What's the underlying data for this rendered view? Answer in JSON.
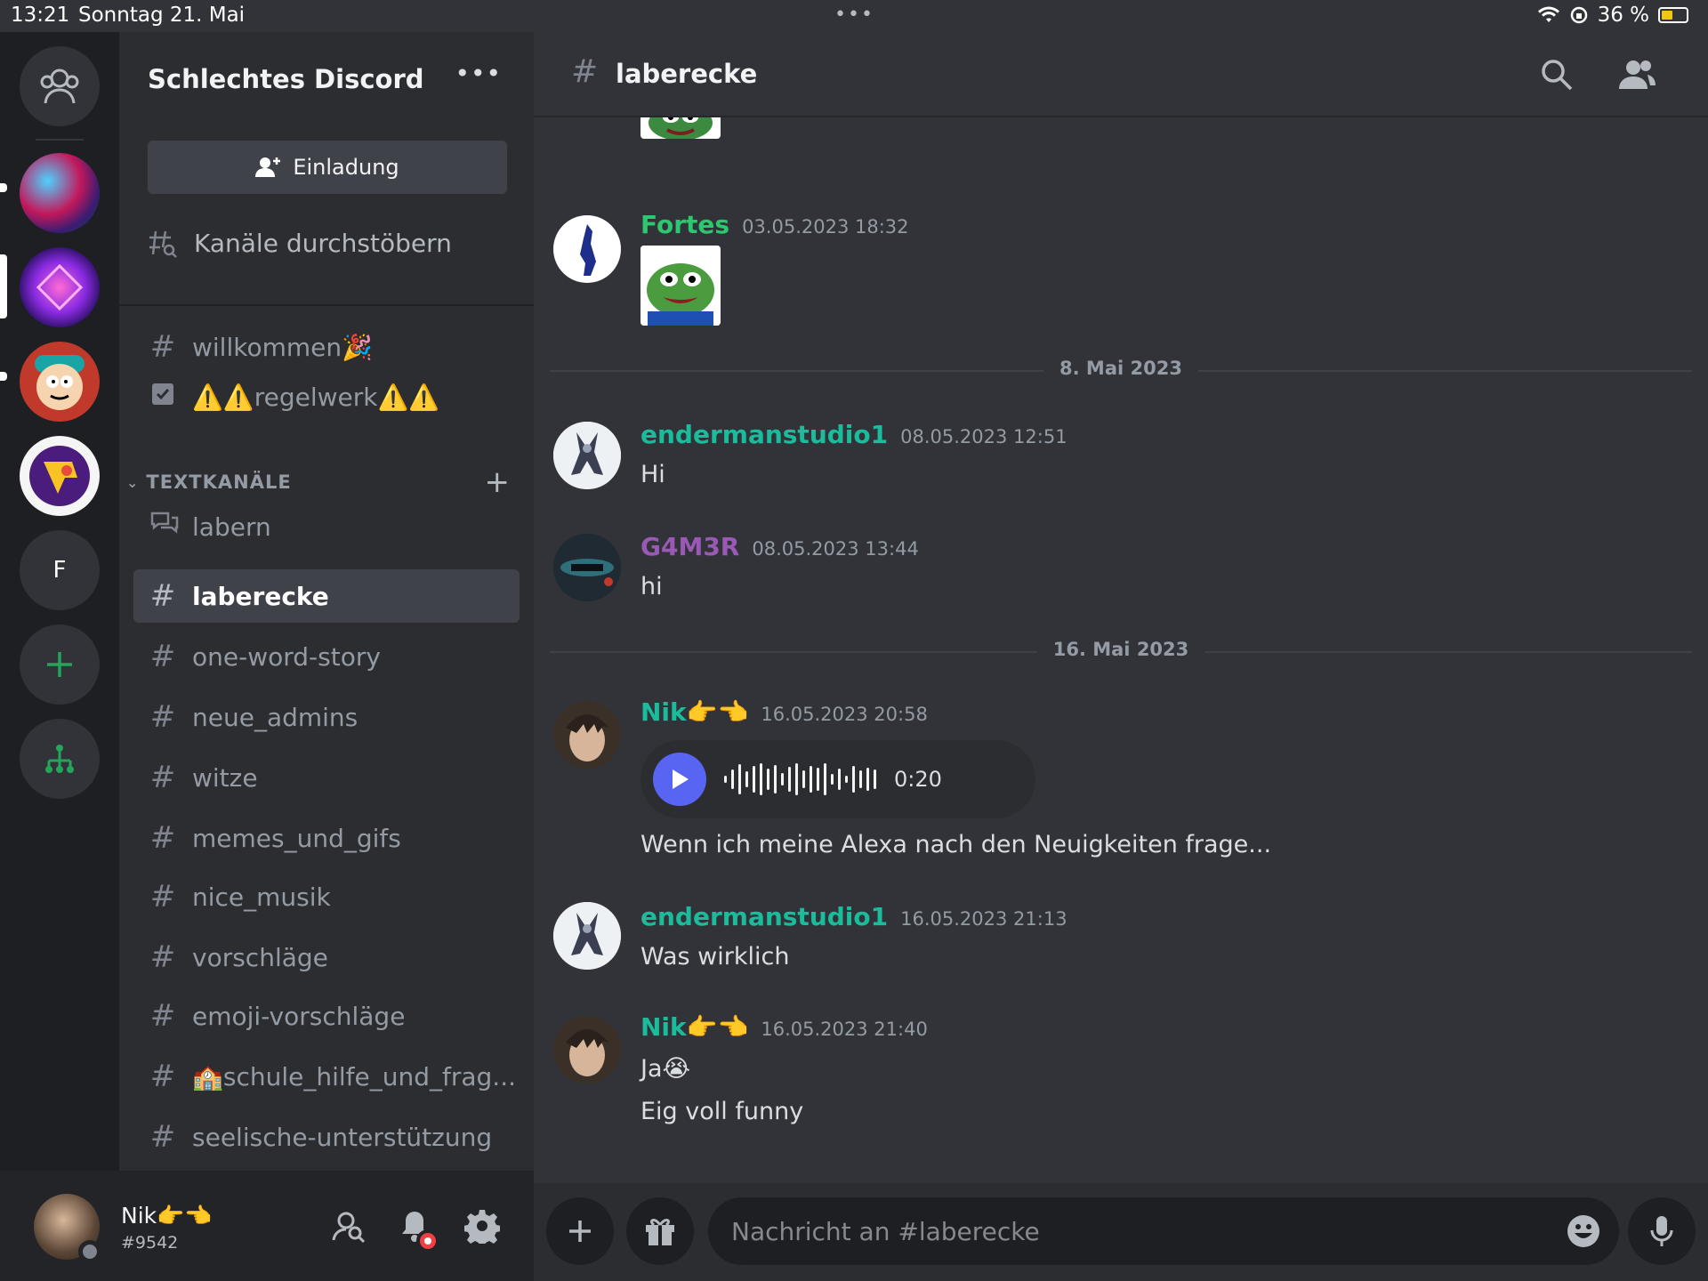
{
  "status_bar": {
    "time": "13:21",
    "date": "Sonntag 21. Mai",
    "battery": "36 %"
  },
  "server_rail": {
    "initial_server": "F"
  },
  "sidebar": {
    "guild_name": "Schlechtes Discord",
    "more": "•••",
    "invite_label": "Einladung",
    "browse_label": "Kanäle durchstöbern",
    "pinned_channels": [
      {
        "label": "willkommen🎉",
        "icon": "hash-icon"
      },
      {
        "label": "⚠️⚠️regelwerk⚠️⚠️",
        "icon": "rules-icon"
      }
    ],
    "category": "TEXTKANÄLE",
    "channels": [
      {
        "label": "labern",
        "icon": "forum-icon"
      },
      {
        "label": "laberecke",
        "icon": "hash-icon",
        "active": true
      },
      {
        "label": "one-word-story",
        "icon": "hash-icon"
      },
      {
        "label": "neue_admins",
        "icon": "hash-icon"
      },
      {
        "label": "witze",
        "icon": "hash-icon"
      },
      {
        "label": "memes_und_gifs",
        "icon": "hash-icon"
      },
      {
        "label": "nice_musik",
        "icon": "hash-icon"
      },
      {
        "label": "vorschläge",
        "icon": "hash-icon"
      },
      {
        "label": "emoji-vorschläge",
        "icon": "hash-icon"
      },
      {
        "label": "🏫schule_hilfe_und_frag...",
        "icon": "hash-icon"
      },
      {
        "label": "seelische-unterstützung",
        "icon": "hash-icon"
      }
    ]
  },
  "user_panel": {
    "name": "Nik👉👈",
    "tag": "#9542"
  },
  "chat": {
    "channel_name": "laberecke",
    "messages": [
      {
        "author": "Fortes",
        "time": "03.05.2023 18:32",
        "color": "#2dc770"
      },
      {
        "author": "endermanstudio1",
        "time": "08.05.2023 12:51",
        "text": "Hi",
        "color": "#1abc9c"
      },
      {
        "author": "G4M3R",
        "time": "08.05.2023 13:44",
        "text": "hi",
        "color": "#9b59b6"
      },
      {
        "author": "Nik👉👈",
        "time": "16.05.2023 20:58",
        "text": "Wenn ich meine Alexa nach den Neuigkeiten frage...",
        "color": "#1abc9c",
        "voice_duration": "0:20"
      },
      {
        "author": "endermanstudio1",
        "time": "16.05.2023 21:13",
        "text": "Was wirklich",
        "color": "#1abc9c"
      },
      {
        "author": "Nik👉👈",
        "time": "16.05.2023 21:40",
        "text": "Ja😭",
        "text2": "Eig voll funny",
        "color": "#1abc9c"
      }
    ],
    "date_dividers": [
      "8. Mai 2023",
      "16. Mai 2023"
    ],
    "composer_placeholder": "Nachricht an #laberecke"
  },
  "colors": {
    "accent": "#5865f2",
    "online_green": "#23a55a",
    "danger": "#f23f43"
  }
}
